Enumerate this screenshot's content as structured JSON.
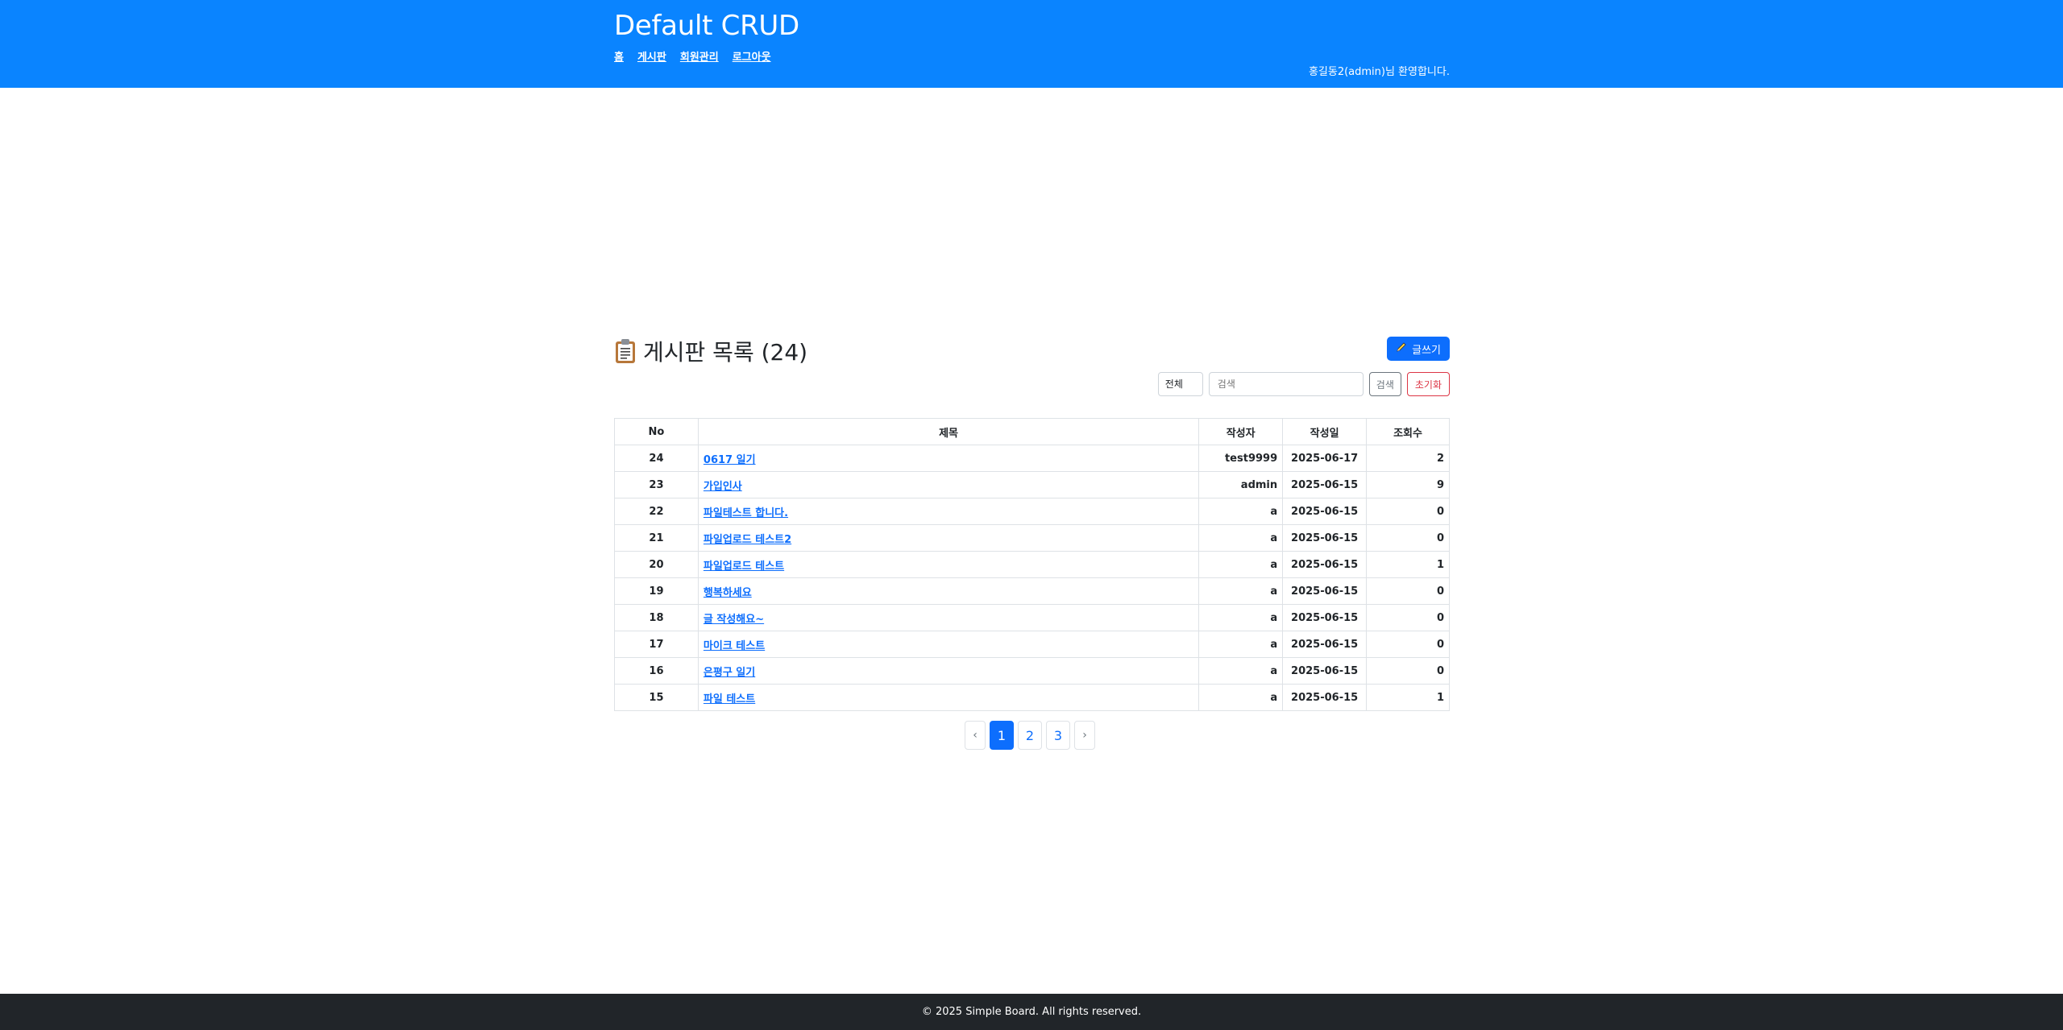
{
  "header": {
    "site_title": "Default CRUD",
    "nav": [
      "홈",
      "게시판",
      "회원관리",
      "로그아웃"
    ],
    "welcome": "홍길동2(admin)님 환영합니다.",
    "bg_color": "#0a84ff"
  },
  "board": {
    "title": "게시판 목록 (24)",
    "title_icon": "clipboard-icon",
    "write_button": "글쓰기",
    "write_icon": "pencil-icon",
    "search": {
      "filter_selected": "전체",
      "placeholder": "검색",
      "search_button": "검색",
      "reset_button": "초기화"
    },
    "columns": [
      "No",
      "제목",
      "작성자",
      "작성일",
      "조회수"
    ],
    "rows": [
      {
        "no": "24",
        "title": "0617 일기",
        "author": "test9999",
        "date": "2025-06-17",
        "views": "2"
      },
      {
        "no": "23",
        "title": "가입인사",
        "author": "admin",
        "date": "2025-06-15",
        "views": "9"
      },
      {
        "no": "22",
        "title": "파일테스트 합니다.",
        "author": "a",
        "date": "2025-06-15",
        "views": "0"
      },
      {
        "no": "21",
        "title": "파일업로드 테스트2",
        "author": "a",
        "date": "2025-06-15",
        "views": "0"
      },
      {
        "no": "20",
        "title": "파일업로드 테스트",
        "author": "a",
        "date": "2025-06-15",
        "views": "1"
      },
      {
        "no": "19",
        "title": "행복하세요",
        "author": "a",
        "date": "2025-06-15",
        "views": "0"
      },
      {
        "no": "18",
        "title": "글 작성해요~",
        "author": "a",
        "date": "2025-06-15",
        "views": "0"
      },
      {
        "no": "17",
        "title": "마이크 테스트",
        "author": "a",
        "date": "2025-06-15",
        "views": "0"
      },
      {
        "no": "16",
        "title": "은평구 일기",
        "author": "a",
        "date": "2025-06-15",
        "views": "0"
      },
      {
        "no": "15",
        "title": "파일 테스트",
        "author": "a",
        "date": "2025-06-15",
        "views": "1"
      }
    ]
  },
  "pagination": {
    "prev": "‹",
    "pages": [
      "1",
      "2",
      "3"
    ],
    "current": "1",
    "next": "›"
  },
  "footer": {
    "text": "© 2025 Simple Board. All rights reserved."
  }
}
